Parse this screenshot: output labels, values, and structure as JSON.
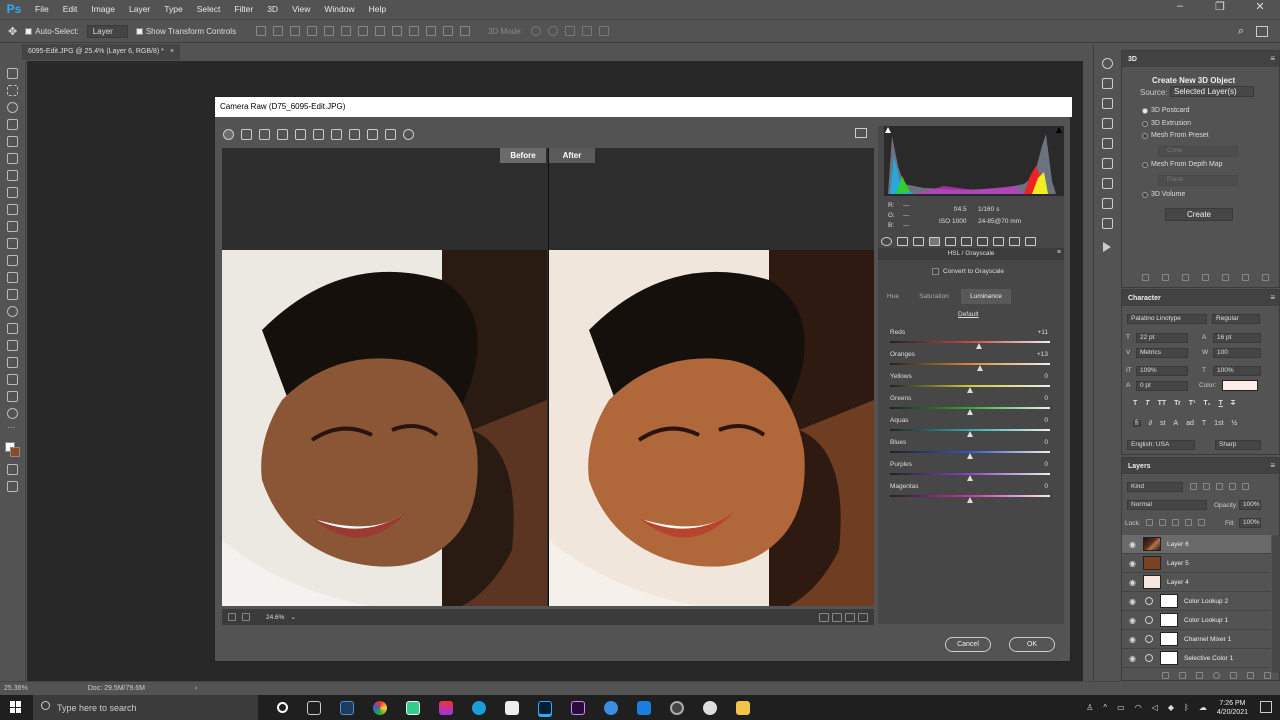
{
  "menubar": {
    "logo": "Ps",
    "items": [
      "File",
      "Edit",
      "Image",
      "Layer",
      "Type",
      "Select",
      "Filter",
      "3D",
      "View",
      "Window",
      "Help"
    ],
    "window_controls": [
      "–",
      "❐",
      "✕"
    ]
  },
  "options_bar": {
    "auto_select_label": "Auto-Select:",
    "auto_select_value": "Layer",
    "show_transform_label": "Show Transform Controls",
    "mode_label": "3D Mode:"
  },
  "doc_tab": {
    "title": "6095-Edit.JPG @ 25.4% (Layer 6, RGB/8) *",
    "close": "×"
  },
  "status_bar": {
    "zoom": "25.36%",
    "doc": "Doc: 29.5M/79.6M",
    "arrow": "›"
  },
  "panel_3d": {
    "tab": "3D",
    "title": "Create New 3D Object",
    "source_label": "Source:",
    "source_value": "Selected Layer(s)",
    "options": [
      "3D Postcard",
      "3D Extrusion",
      "Mesh From Preset",
      "Mesh From Depth Map",
      "3D Volume"
    ],
    "preset_dd": "Cone",
    "depth_dd": "Plane",
    "create_btn": "Create"
  },
  "panel_character": {
    "tab": "Character",
    "font": "Palatino Linotype",
    "style": "Regular",
    "size": "22 pt",
    "leading": "16 pt",
    "kerning": "Metrics",
    "tracking": "100",
    "vscale": "109%",
    "hscale": "100%",
    "baseline": "0 pt",
    "color_label": "Color:",
    "language": "English: USA",
    "aa": "Sharp",
    "type_buttons": [
      "T",
      "T",
      "TT",
      "Tr",
      "T¹",
      "T₁",
      "T",
      "T"
    ],
    "ot_buttons": [
      "fi",
      "∂",
      "st",
      "A",
      "ad",
      "T",
      "1st",
      "½"
    ]
  },
  "panel_layers": {
    "tab": "Layers",
    "kind": "Kind",
    "blend": "Normal",
    "opacity_label": "Opacity:",
    "opacity": "100%",
    "lock_label": "Lock:",
    "fill_label": "Fill:",
    "fill": "100%",
    "layers": [
      {
        "name": "Layer 6",
        "kind": "photo"
      },
      {
        "name": "Layer 5",
        "kind": "brown"
      },
      {
        "name": "Layer 4",
        "kind": "pale"
      },
      {
        "name": "Color Lookup 2",
        "kind": "adj"
      },
      {
        "name": "Color Lookup 1",
        "kind": "adj"
      },
      {
        "name": "Channel Mixer 1",
        "kind": "adj"
      },
      {
        "name": "Selective Color 1",
        "kind": "adj"
      }
    ]
  },
  "camera_raw": {
    "title": "Camera Raw (D75_6095-Edit.JPG)",
    "before": "Before",
    "after": "After",
    "zoom": "24.6%",
    "rgb": {
      "r": "R:",
      "g": "G:",
      "b": "B:",
      "dash": "---"
    },
    "exif": {
      "aperture": "f/4.5",
      "shutter": "1/160 s",
      "iso": "ISO 1000",
      "lens": "24-85@70 mm"
    },
    "panel_title": "HSL / Grayscale",
    "convert_label": "Convert to Grayscale",
    "subtabs": [
      "Hue",
      "Saturation",
      "Luminance"
    ],
    "default_link": "Default",
    "sliders": [
      {
        "label": "Reds",
        "value": "+11",
        "num": 11,
        "colors": [
          "#c44",
          "#c44"
        ]
      },
      {
        "label": "Oranges",
        "value": "+13",
        "num": 13,
        "colors": [
          "#d83",
          "#d83"
        ]
      },
      {
        "label": "Yellows",
        "value": "0",
        "num": 0,
        "colors": [
          "#cc3",
          "#cc3"
        ]
      },
      {
        "label": "Greens",
        "value": "0",
        "num": 0,
        "colors": [
          "#3a3",
          "#3a3"
        ]
      },
      {
        "label": "Aquas",
        "value": "0",
        "num": 0,
        "colors": [
          "#3aa",
          "#3aa"
        ]
      },
      {
        "label": "Blues",
        "value": "0",
        "num": 0,
        "colors": [
          "#35c",
          "#35c"
        ]
      },
      {
        "label": "Purples",
        "value": "0",
        "num": 0,
        "colors": [
          "#84c",
          "#84c"
        ]
      },
      {
        "label": "Magentas",
        "value": "0",
        "num": 0,
        "colors": [
          "#c3a",
          "#c3a"
        ]
      }
    ],
    "cancel": "Cancel",
    "ok": "OK"
  },
  "taskbar": {
    "search_placeholder": "Type here to search",
    "time": "7:26 PM",
    "date": "4/20/2021"
  }
}
